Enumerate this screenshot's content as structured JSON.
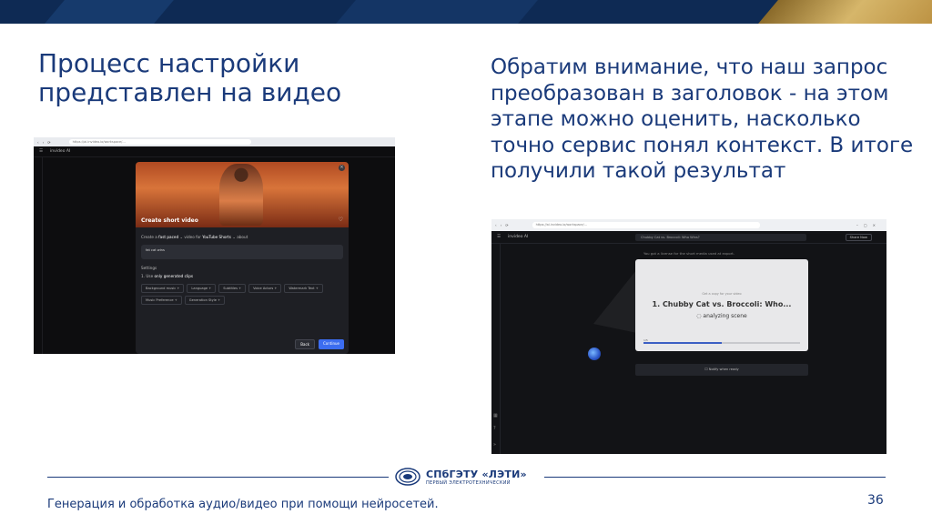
{
  "slide": {
    "title_left": "Процесс настройки представлен на видео",
    "title_right": "Обратим внимание, что наш запрос преобразован в заголовок - на этом этапе можно оценить, насколько точно сервис понял контекст. В итоге получили такой результат",
    "footer_text": "Генерация и обработка аудио/видео при помощи нейросетей.",
    "page_number": "36",
    "logo_name": "СПбГЭТУ «ЛЭТИ»",
    "logo_tagline": "ПЕРВЫЙ ЭЛЕКТРОТЕХНИЧЕСКИЙ"
  },
  "screenshot_setup": {
    "url": "https://ai.invideo.io/workspace/...",
    "app_name": "invideo AI",
    "modal_title": "Create short video",
    "line_create": "Create a",
    "line_value1": "fast paced",
    "line_mid": "video for",
    "line_value2": "YouTube Shorts",
    "line_about": "about",
    "prompt_text": "fat cat wins",
    "settings_label": "Settings",
    "use_label": "1. Use",
    "use_value": "only generated clips",
    "chips": [
      "Background music +",
      "Language +",
      "Subtitles +",
      "Voice Actors +",
      "Watermark Text +",
      "Music Preference +",
      "Generation Style +"
    ],
    "back_label": "Back",
    "continue_label": "Continue"
  },
  "screenshot_result": {
    "url": "https://ai.invideo.io/workspace/...",
    "app_name": "invideo AI",
    "search_text": "Chubby Cat vs. Broccoli: Who Wins?",
    "share_label": "Share Now",
    "hint_text": "You got a license for the short media used at export.",
    "card_subtitle": "Get a copy for your video",
    "card_title": "1. Chubby Cat vs. Broccoli: Who...",
    "status_text": "analyzing scene",
    "progress_label": "1/5",
    "progress_fraction": 0.5,
    "notify_label": "Notify when ready"
  }
}
